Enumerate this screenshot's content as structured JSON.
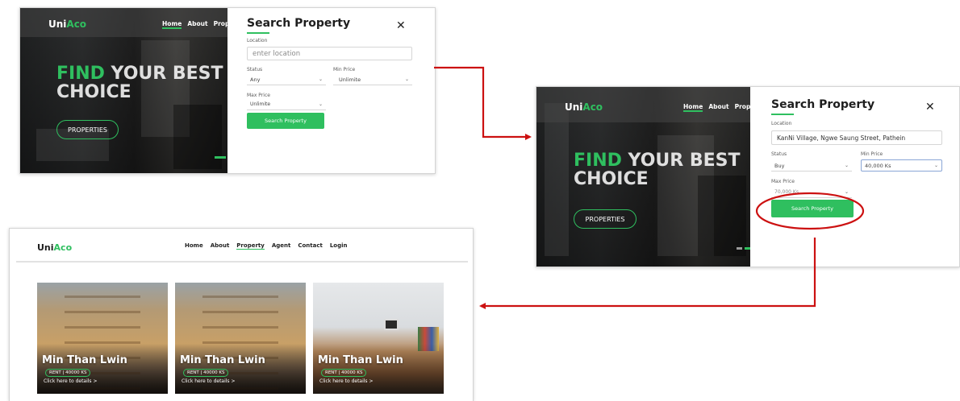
{
  "brand": {
    "part1": "Uni",
    "part2": "Aco"
  },
  "colors": {
    "accent": "#2fbf5f",
    "annotation": "#cc1111",
    "dark_text": "#1e1e1e"
  },
  "hero": {
    "nav": [
      "Home",
      "About",
      "Prop"
    ],
    "headline_highlight": "FIND",
    "headline_rest": " YOUR BEST",
    "headline_line2": "CHOICE",
    "cta": "PROPERTIES"
  },
  "search_empty": {
    "title": "Search Property",
    "close": "✕",
    "location_label": "Location",
    "location_placeholder": "enter location",
    "status_label": "Status",
    "status_value": "Any",
    "min_label": "Min Price",
    "min_value": "Unlimite",
    "max_label": "Max Price",
    "max_value": "Unlimite",
    "button": "Search Property"
  },
  "search_filled": {
    "title": "Search Property",
    "close": "✕",
    "location_label": "Location",
    "location_value": "KanNi Village, Ngwe Saung Street, Pathein",
    "status_label": "Status",
    "status_value": "Buy",
    "min_label": "Min Price",
    "min_value": "40,000 Ks",
    "max_label": "Max Price",
    "max_value": "70,000 Ks",
    "button": "Search Property"
  },
  "results": {
    "nav": [
      "Home",
      "About",
      "Property",
      "Agent",
      "Contact",
      "Login"
    ],
    "active_nav": "Property",
    "cards": [
      {
        "name": "Min Than Lwin",
        "badge": "RENT | 40000 KS",
        "link": "Click here to details >"
      },
      {
        "name": "Min Than Lwin",
        "badge": "RENT | 40000 KS",
        "link": "Click here to details >"
      },
      {
        "name": "Min Than Lwin",
        "badge": "RENT | 40000 KS",
        "link": "Click here to details >"
      }
    ]
  },
  "icons": {
    "close": "close-icon",
    "chevron": "chevron-down-icon",
    "arrow": "arrow-icon"
  }
}
